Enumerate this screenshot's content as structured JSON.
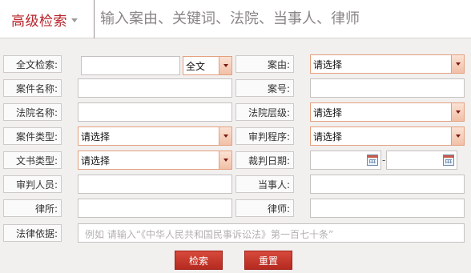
{
  "header": {
    "advanced_search": "高级检索",
    "search_placeholder": "输入案由、关键词、法院、当事人、律师"
  },
  "form": {
    "fulltext_label": "全文检索:",
    "fulltext_scope": "全文",
    "cause_label": "案由:",
    "cause_value": "请选择",
    "case_name_label": "案件名称:",
    "case_no_label": "案号:",
    "court_name_label": "法院名称:",
    "court_level_label": "法院层级:",
    "court_level_value": "请选择",
    "case_type_label": "案件类型:",
    "case_type_value": "请选择",
    "procedure_label": "审判程序:",
    "procedure_value": "请选择",
    "doc_type_label": "文书类型:",
    "doc_type_value": "请选择",
    "judge_date_label": "裁判日期:",
    "date_separator": "-",
    "judge_label": "审判人员:",
    "party_label": "当事人:",
    "law_firm_label": "律所:",
    "lawyer_label": "律师:",
    "legal_basis_label": "法律依据:",
    "legal_basis_placeholder": "例如 请输入“《中华人民共和国民事诉讼法》第一百七十条”"
  },
  "buttons": {
    "search": "检索",
    "reset": "重置"
  },
  "colors": {
    "brand_red": "#b8232a",
    "select_border": "#e3a07e",
    "button": "#c7362a"
  }
}
